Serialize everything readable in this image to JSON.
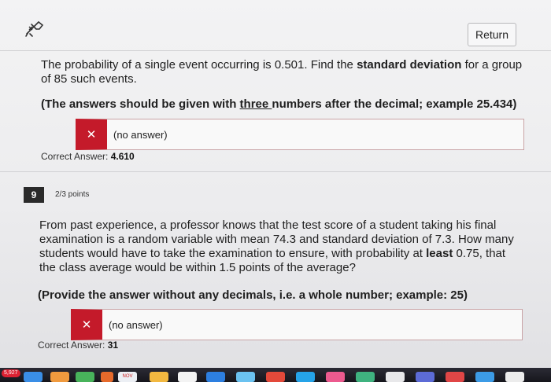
{
  "header": {
    "return_label": "Return"
  },
  "q8": {
    "line1_pre": "The probability of a single event occurring is 0.501. Find the ",
    "line1_bold": "standard deviation",
    "line1_post": " for a group",
    "line2": "of 85 such events.",
    "instr_pre": "(The answers should be given with ",
    "instr_underline": "three ",
    "instr_post": "numbers after the decimal; example 25.434)",
    "answer": "(no answer)",
    "correct_label": "Correct Answer:",
    "correct_value": "4.610"
  },
  "q9": {
    "number": "9",
    "points": "2/3 points",
    "line1": "From past experience, a professor knows that the test score of a student taking his final",
    "line2": "examination is a random variable with mean 74.3 and standard deviation of 7.3.  How many",
    "line3_pre": "students would have to take the examination to ensure, with probability at ",
    "line3_bold": "least",
    "line3_post": " 0.75, that",
    "line4": "the class average would be within 1.5 points of the average?",
    "instr": "(Provide the answer without any decimals, i.e. a whole number; example: 25)",
    "answer": "(no answer)",
    "correct_label": "Correct Answer:",
    "correct_value": "31"
  },
  "dock": {
    "badge": "5,927",
    "calendar_label": "NOV"
  },
  "colors": {
    "incorrect": "#c41a2a",
    "number_badge": "#2a2a2a"
  }
}
